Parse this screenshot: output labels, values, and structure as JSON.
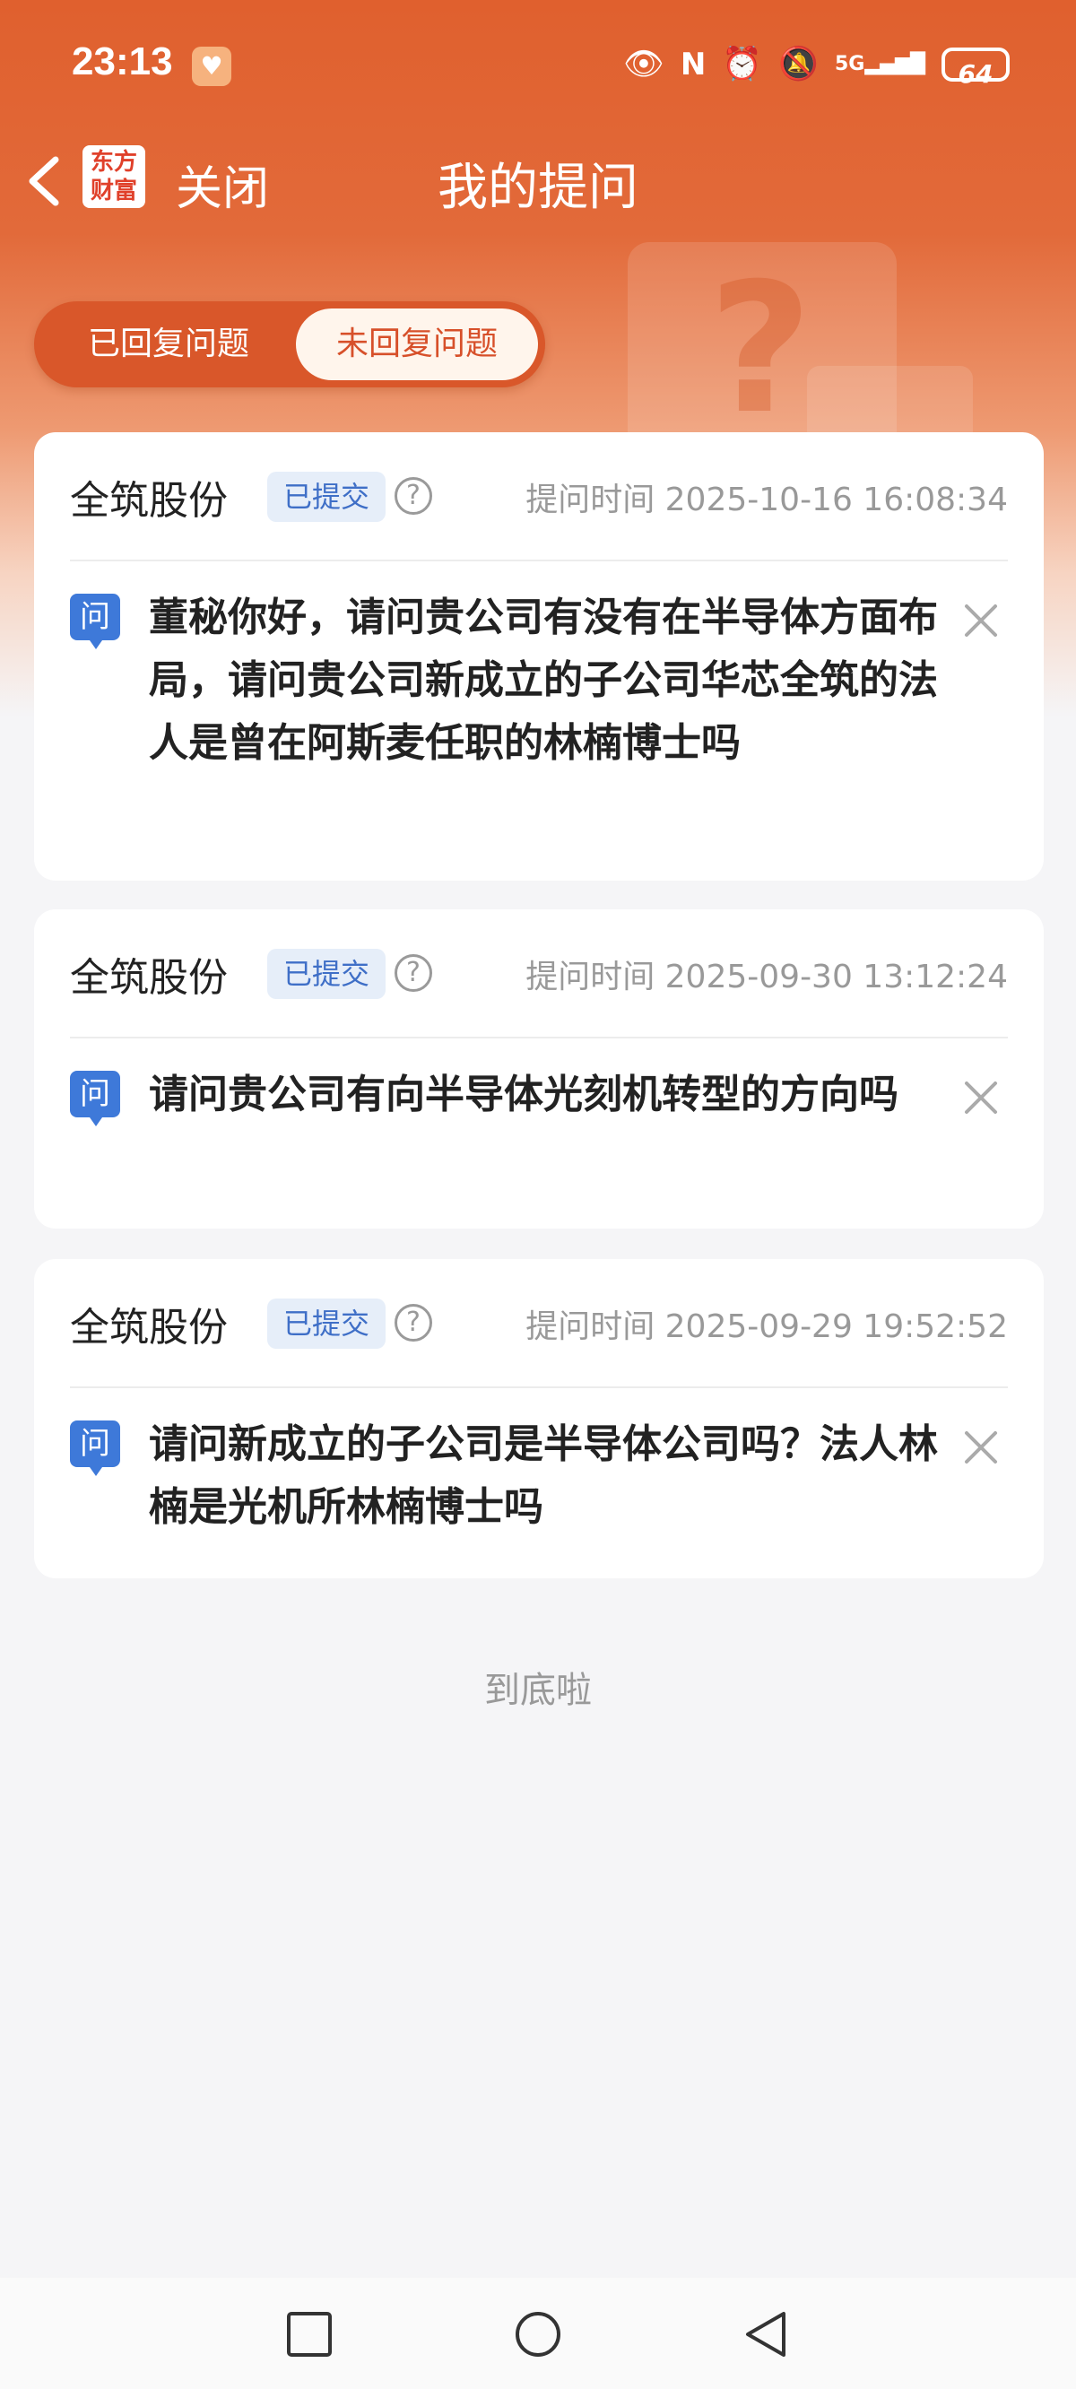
{
  "status_bar": {
    "time": "23:13",
    "battery": "64",
    "network": "5G"
  },
  "nav": {
    "logo_text": "东方财富",
    "close_label": "关闭",
    "title": "我的提问"
  },
  "tabs": [
    {
      "label": "已回复问题",
      "active": false
    },
    {
      "label": "未回复问题",
      "active": true
    }
  ],
  "questions": [
    {
      "company": "全筑股份",
      "status": "已提交",
      "time_label": "提问时间 2025-10-16 16:08:34",
      "q_icon": "问",
      "text": "董秘你好，请问贵公司有没有在半导体方面布局，请问贵公司新成立的子公司华芯全筑的法人是曾在阿斯麦任职的林楠博士吗"
    },
    {
      "company": "全筑股份",
      "status": "已提交",
      "time_label": "提问时间 2025-09-30 13:12:24",
      "q_icon": "问",
      "text": "请问贵公司有向半导体光刻机转型的方向吗"
    },
    {
      "company": "全筑股份",
      "status": "已提交",
      "time_label": "提问时间 2025-09-29 19:52:52",
      "q_icon": "问",
      "text": "请问新成立的子公司是半导体公司吗？法人林楠是光机所林楠博士吗"
    }
  ],
  "end_text": "到底啦",
  "colors": {
    "brand_orange": "#e0602e",
    "badge_blue": "#3f6fc7",
    "question_icon_blue": "#3e79d9"
  }
}
